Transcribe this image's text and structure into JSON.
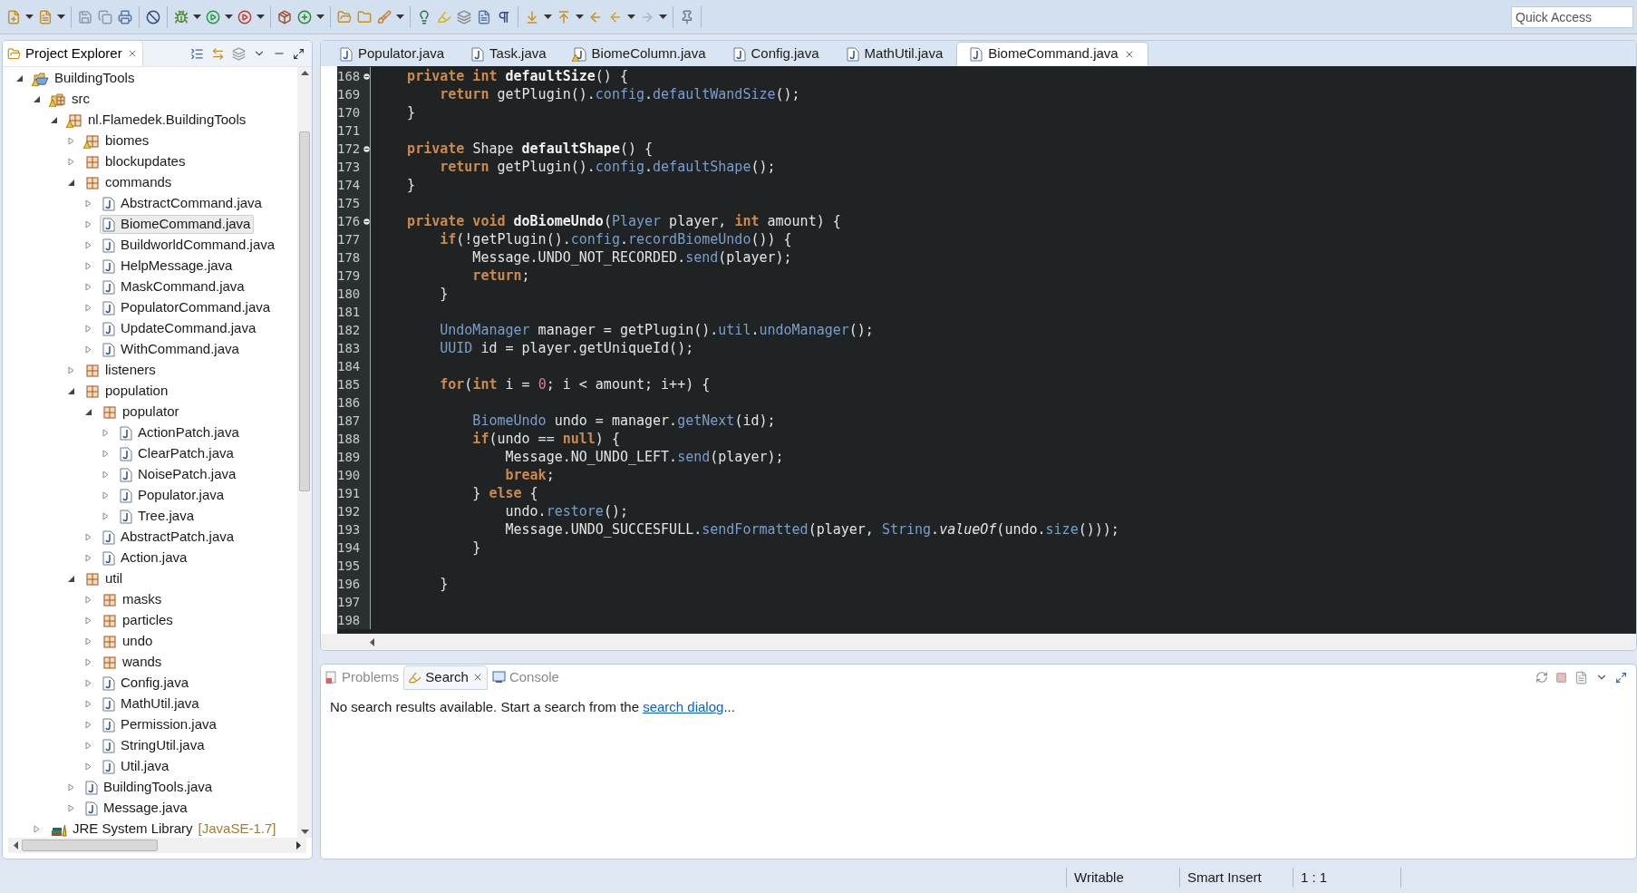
{
  "toolbar": {
    "quick_access": {
      "placeholder": "Quick Access"
    }
  },
  "project_explorer": {
    "title": "Project Explorer",
    "tree": [
      {
        "label": "BuildingTools",
        "kind": "project",
        "expanded": true,
        "selected": false,
        "warning": true,
        "children": [
          {
            "label": "src",
            "kind": "source-folder",
            "expanded": true,
            "selected": false,
            "warning": true,
            "children": [
              {
                "label": "nl.Flamedek.BuildingTools",
                "kind": "package",
                "expanded": true,
                "selected": false,
                "warning": true,
                "children": [
                  {
                    "label": "biomes",
                    "kind": "package",
                    "expanded": false,
                    "selected": false,
                    "warning": true
                  },
                  {
                    "label": "blockupdates",
                    "kind": "package",
                    "expanded": false,
                    "selected": false,
                    "warning": false
                  },
                  {
                    "label": "commands",
                    "kind": "package",
                    "expanded": true,
                    "selected": false,
                    "warning": false,
                    "children": [
                      {
                        "label": "AbstractCommand.java",
                        "kind": "file",
                        "expanded": false,
                        "selected": false,
                        "warning": false
                      },
                      {
                        "label": "BiomeCommand.java",
                        "kind": "file",
                        "expanded": false,
                        "selected": true,
                        "warning": false
                      },
                      {
                        "label": "BuildworldCommand.java",
                        "kind": "file",
                        "expanded": false,
                        "selected": false,
                        "warning": false
                      },
                      {
                        "label": "HelpMessage.java",
                        "kind": "file",
                        "expanded": false,
                        "selected": false,
                        "warning": false
                      },
                      {
                        "label": "MaskCommand.java",
                        "kind": "file",
                        "expanded": false,
                        "selected": false,
                        "warning": false
                      },
                      {
                        "label": "PopulatorCommand.java",
                        "kind": "file",
                        "expanded": false,
                        "selected": false,
                        "warning": false
                      },
                      {
                        "label": "UpdateCommand.java",
                        "kind": "file",
                        "expanded": false,
                        "selected": false,
                        "warning": false
                      },
                      {
                        "label": "WithCommand.java",
                        "kind": "file",
                        "expanded": false,
                        "selected": false,
                        "warning": false
                      }
                    ]
                  },
                  {
                    "label": "listeners",
                    "kind": "package",
                    "expanded": false,
                    "selected": false,
                    "warning": false
                  },
                  {
                    "label": "population",
                    "kind": "package",
                    "expanded": true,
                    "selected": false,
                    "warning": false,
                    "children": [
                      {
                        "label": "populator",
                        "kind": "package",
                        "expanded": true,
                        "selected": false,
                        "warning": false,
                        "children": [
                          {
                            "label": "ActionPatch.java",
                            "kind": "file",
                            "expanded": false,
                            "selected": false,
                            "warning": false
                          },
                          {
                            "label": "ClearPatch.java",
                            "kind": "file",
                            "expanded": false,
                            "selected": false,
                            "warning": false
                          },
                          {
                            "label": "NoisePatch.java",
                            "kind": "file",
                            "expanded": false,
                            "selected": false,
                            "warning": false
                          },
                          {
                            "label": "Populator.java",
                            "kind": "file",
                            "expanded": false,
                            "selected": false,
                            "warning": false
                          },
                          {
                            "label": "Tree.java",
                            "kind": "file",
                            "expanded": false,
                            "selected": false,
                            "warning": false
                          }
                        ]
                      },
                      {
                        "label": "AbstractPatch.java",
                        "kind": "file",
                        "expanded": false,
                        "selected": false,
                        "warning": false
                      },
                      {
                        "label": "Action.java",
                        "kind": "file",
                        "expanded": false,
                        "selected": false,
                        "warning": false
                      }
                    ]
                  },
                  {
                    "label": "util",
                    "kind": "package",
                    "expanded": true,
                    "selected": false,
                    "warning": false,
                    "children": [
                      {
                        "label": "masks",
                        "kind": "package",
                        "expanded": false,
                        "selected": false,
                        "warning": false
                      },
                      {
                        "label": "particles",
                        "kind": "package",
                        "expanded": false,
                        "selected": false,
                        "warning": false
                      },
                      {
                        "label": "undo",
                        "kind": "package",
                        "expanded": false,
                        "selected": false,
                        "warning": false
                      },
                      {
                        "label": "wands",
                        "kind": "package",
                        "expanded": false,
                        "selected": false,
                        "warning": false
                      },
                      {
                        "label": "Config.java",
                        "kind": "file",
                        "expanded": false,
                        "selected": false,
                        "warning": false
                      },
                      {
                        "label": "MathUtil.java",
                        "kind": "file",
                        "expanded": false,
                        "selected": false,
                        "warning": false
                      },
                      {
                        "label": "Permission.java",
                        "kind": "file",
                        "expanded": false,
                        "selected": false,
                        "warning": false
                      },
                      {
                        "label": "StringUtil.java",
                        "kind": "file",
                        "expanded": false,
                        "selected": false,
                        "warning": false
                      },
                      {
                        "label": "Util.java",
                        "kind": "file",
                        "expanded": false,
                        "selected": false,
                        "warning": false
                      }
                    ]
                  },
                  {
                    "label": "BuildingTools.java",
                    "kind": "file",
                    "expanded": false,
                    "selected": false,
                    "warning": false
                  },
                  {
                    "label": "Message.java",
                    "kind": "file",
                    "expanded": false,
                    "selected": false,
                    "warning": false
                  }
                ]
              }
            ]
          },
          {
            "label": "JRE System Library",
            "decoration": "[JavaSE-1.7]",
            "kind": "library",
            "expanded": false,
            "selected": false,
            "warning": false
          }
        ]
      }
    ]
  },
  "editor": {
    "tabs": [
      {
        "label": "Populator.java",
        "selected": false,
        "warning": false
      },
      {
        "label": "Task.java",
        "selected": false,
        "warning": false
      },
      {
        "label": "BiomeColumn.java",
        "selected": false,
        "warning": true
      },
      {
        "label": "Config.java",
        "selected": false,
        "warning": false
      },
      {
        "label": "MathUtil.java",
        "selected": false,
        "warning": false
      },
      {
        "label": "BiomeCommand.java",
        "selected": true,
        "warning": false
      }
    ],
    "lines": [
      {
        "number": "168",
        "fold": true,
        "tokens": [
          {
            "kind": "kw",
            "text": "    private int "
          },
          {
            "kind": "decl",
            "text": "defaultSize"
          },
          {
            "kind": "plain",
            "text": "() {"
          }
        ]
      },
      {
        "number": "169",
        "fold": false,
        "tokens": [
          {
            "kind": "kw",
            "text": "        return "
          },
          {
            "kind": "plain",
            "text": "getPlugin()."
          },
          {
            "kind": "member",
            "text": "config"
          },
          {
            "kind": "plain",
            "text": "."
          },
          {
            "kind": "member",
            "text": "defaultWandSize"
          },
          {
            "kind": "plain",
            "text": "();"
          }
        ]
      },
      {
        "number": "170",
        "fold": false,
        "tokens": [
          {
            "kind": "plain",
            "text": "    }"
          }
        ]
      },
      {
        "number": "171",
        "fold": false
      },
      {
        "number": "172",
        "fold": true,
        "tokens": [
          {
            "kind": "kw",
            "text": "    private "
          },
          {
            "kind": "plain",
            "text": "Shape "
          },
          {
            "kind": "decl",
            "text": "defaultShape"
          },
          {
            "kind": "plain",
            "text": "() {"
          }
        ]
      },
      {
        "number": "173",
        "fold": false,
        "tokens": [
          {
            "kind": "kw",
            "text": "        return "
          },
          {
            "kind": "plain",
            "text": "getPlugin()."
          },
          {
            "kind": "member",
            "text": "config"
          },
          {
            "kind": "plain",
            "text": "."
          },
          {
            "kind": "member",
            "text": "defaultShape"
          },
          {
            "kind": "plain",
            "text": "();"
          }
        ]
      },
      {
        "number": "174",
        "fold": false,
        "tokens": [
          {
            "kind": "plain",
            "text": "    }"
          }
        ]
      },
      {
        "number": "175",
        "fold": false
      },
      {
        "number": "176",
        "fold": true,
        "tokens": [
          {
            "kind": "kw",
            "text": "    private void "
          },
          {
            "kind": "decl",
            "text": "doBiomeUndo"
          },
          {
            "kind": "plain",
            "text": "("
          },
          {
            "kind": "member",
            "text": "Player"
          },
          {
            "kind": "plain",
            "text": " player, "
          },
          {
            "kind": "kw",
            "text": "int"
          },
          {
            "kind": "plain",
            "text": " amount) {"
          }
        ]
      },
      {
        "number": "177",
        "fold": false,
        "tokens": [
          {
            "kind": "kw",
            "text": "        if"
          },
          {
            "kind": "plain",
            "text": "(!getPlugin()."
          },
          {
            "kind": "member",
            "text": "config"
          },
          {
            "kind": "plain",
            "text": "."
          },
          {
            "kind": "member",
            "text": "recordBiomeUndo"
          },
          {
            "kind": "plain",
            "text": "()) {"
          }
        ]
      },
      {
        "number": "178",
        "fold": false,
        "tokens": [
          {
            "kind": "plain",
            "text": "            Message.UNDO_NOT_RECORDED."
          },
          {
            "kind": "member",
            "text": "send"
          },
          {
            "kind": "plain",
            "text": "(player);"
          }
        ]
      },
      {
        "number": "179",
        "fold": false,
        "tokens": [
          {
            "kind": "kw",
            "text": "            return"
          },
          {
            "kind": "plain",
            "text": ";"
          }
        ]
      },
      {
        "number": "180",
        "fold": false,
        "tokens": [
          {
            "kind": "plain",
            "text": "        }"
          }
        ]
      },
      {
        "number": "181",
        "fold": false
      },
      {
        "number": "182",
        "fold": false,
        "tokens": [
          {
            "kind": "member",
            "text": "        UndoManager"
          },
          {
            "kind": "plain",
            "text": " manager = getPlugin()."
          },
          {
            "kind": "member",
            "text": "util"
          },
          {
            "kind": "plain",
            "text": "."
          },
          {
            "kind": "member",
            "text": "undoManager"
          },
          {
            "kind": "plain",
            "text": "();"
          }
        ]
      },
      {
        "number": "183",
        "fold": false,
        "tokens": [
          {
            "kind": "member",
            "text": "        UUID"
          },
          {
            "kind": "plain",
            "text": " id = player.getUniqueId();"
          }
        ]
      },
      {
        "number": "184",
        "fold": false
      },
      {
        "number": "185",
        "fold": false,
        "tokens": [
          {
            "kind": "kw",
            "text": "        for"
          },
          {
            "kind": "plain",
            "text": "("
          },
          {
            "kind": "kw",
            "text": "int"
          },
          {
            "kind": "plain",
            "text": " i = "
          },
          {
            "kind": "num",
            "text": "0"
          },
          {
            "kind": "plain",
            "text": "; i < amount; i++) {"
          }
        ]
      },
      {
        "number": "186",
        "fold": false
      },
      {
        "number": "187",
        "fold": false,
        "tokens": [
          {
            "kind": "member",
            "text": "            BiomeUndo"
          },
          {
            "kind": "plain",
            "text": " undo = manager."
          },
          {
            "kind": "member",
            "text": "getNext"
          },
          {
            "kind": "plain",
            "text": "(id);"
          }
        ]
      },
      {
        "number": "188",
        "fold": false,
        "tokens": [
          {
            "kind": "kw",
            "text": "            if"
          },
          {
            "kind": "plain",
            "text": "(undo == "
          },
          {
            "kind": "kw",
            "text": "null"
          },
          {
            "kind": "plain",
            "text": ") {"
          }
        ]
      },
      {
        "number": "189",
        "fold": false,
        "tokens": [
          {
            "kind": "plain",
            "text": "                Message.NO_UNDO_LEFT."
          },
          {
            "kind": "member",
            "text": "send"
          },
          {
            "kind": "plain",
            "text": "(player);"
          }
        ]
      },
      {
        "number": "190",
        "fold": false,
        "tokens": [
          {
            "kind": "kw",
            "text": "                break"
          },
          {
            "kind": "plain",
            "text": ";"
          }
        ]
      },
      {
        "number": "191",
        "fold": false,
        "tokens": [
          {
            "kind": "plain",
            "text": "            } "
          },
          {
            "kind": "kw",
            "text": "else"
          },
          {
            "kind": "plain",
            "text": " {"
          }
        ]
      },
      {
        "number": "192",
        "fold": false,
        "tokens": [
          {
            "kind": "plain",
            "text": "                undo."
          },
          {
            "kind": "member",
            "text": "restore"
          },
          {
            "kind": "plain",
            "text": "();"
          }
        ]
      },
      {
        "number": "193",
        "fold": false,
        "tokens": [
          {
            "kind": "plain",
            "text": "                Message.UNDO_SUCCESFULL."
          },
          {
            "kind": "member",
            "text": "sendFormatted"
          },
          {
            "kind": "plain",
            "text": "(player, "
          },
          {
            "kind": "member",
            "text": "String"
          },
          {
            "kind": "plain",
            "text": "."
          },
          {
            "kind": "italic",
            "text": "valueOf"
          },
          {
            "kind": "plain",
            "text": "(undo."
          },
          {
            "kind": "member",
            "text": "size"
          },
          {
            "kind": "plain",
            "text": "()));"
          }
        ]
      },
      {
        "number": "194",
        "fold": false,
        "tokens": [
          {
            "kind": "plain",
            "text": "            }"
          }
        ]
      },
      {
        "number": "195",
        "fold": false
      },
      {
        "number": "196",
        "fold": false,
        "tokens": [
          {
            "kind": "plain",
            "text": "        }"
          }
        ]
      },
      {
        "number": "197",
        "fold": false
      },
      {
        "number": "198",
        "fold": false
      }
    ]
  },
  "bottom_panel": {
    "tabs": [
      {
        "label": "Problems",
        "kind": "problems",
        "selected": false
      },
      {
        "label": "Search",
        "kind": "search",
        "selected": true
      },
      {
        "label": "Console",
        "kind": "console",
        "selected": false
      }
    ],
    "message": {
      "text": "No search results available. Start a search from the ",
      "link": "search dialog",
      "suffix": "..."
    }
  },
  "status_bar": [
    "Writable",
    "Smart Insert",
    "1 : 1"
  ]
}
